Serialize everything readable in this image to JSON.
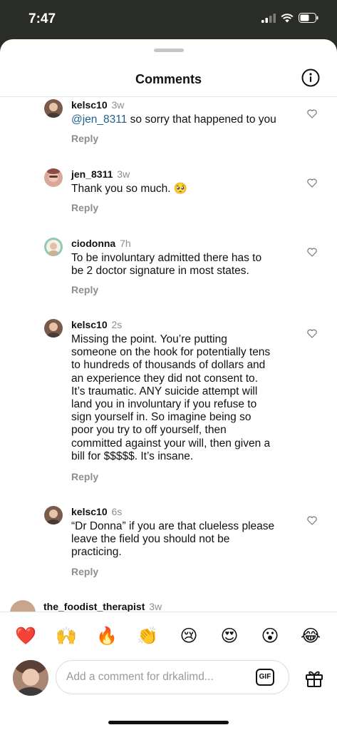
{
  "status": {
    "time": "7:47"
  },
  "header": {
    "title": "Comments",
    "info_icon": "info-circle-icon"
  },
  "comments": [
    {
      "user": "kelsc10",
      "time": "3w",
      "mention": "@jen_8311",
      "text": " so sorry that happened to you",
      "reply": "Reply"
    },
    {
      "user": "jen_8311",
      "time": "3w",
      "text": "Thank you so much. 🥺",
      "reply": "Reply"
    },
    {
      "user": "ciodonna",
      "time": "7h",
      "text": "To be involuntary admitted there has to\nbe 2 doctor signature in most states.",
      "reply": "Reply"
    },
    {
      "user": "kelsc10",
      "time": "2s",
      "text": "Missing the point.  You’re putting\nsomeone on the hook for potentially tens\nto hundreds of thousands of dollars and\nan experience they did not consent to.\nIt’s traumatic.  ANY suicide attempt will\nland you in involuntary if you refuse to\nsign yourself in.  So imagine being so\npoor you try to off yourself, then\ncommitted against your will, then given a\nbill for $$$$$.  It’s insane.",
      "reply": "Reply"
    },
    {
      "user": "kelsc10",
      "time": "6s",
      "text": "“Dr Donna” if you are that clueless please\nleave the field you should not be\npracticing.",
      "reply": "Reply"
    }
  ],
  "partial_comment": {
    "user": "the_foodist_therapist",
    "time": "3w"
  },
  "quick_reactions": [
    "❤️",
    "🙌",
    "🔥",
    "👏",
    "😢",
    "😍",
    "😮",
    "😂"
  ],
  "composer": {
    "placeholder": "Add a comment for drkalimd...",
    "gif_label": "GIF",
    "gift_icon": "gift-icon"
  },
  "colors": {
    "mention": "#1f5f8e",
    "muted": "#8e8e8e",
    "sheet": "#ffffff"
  }
}
